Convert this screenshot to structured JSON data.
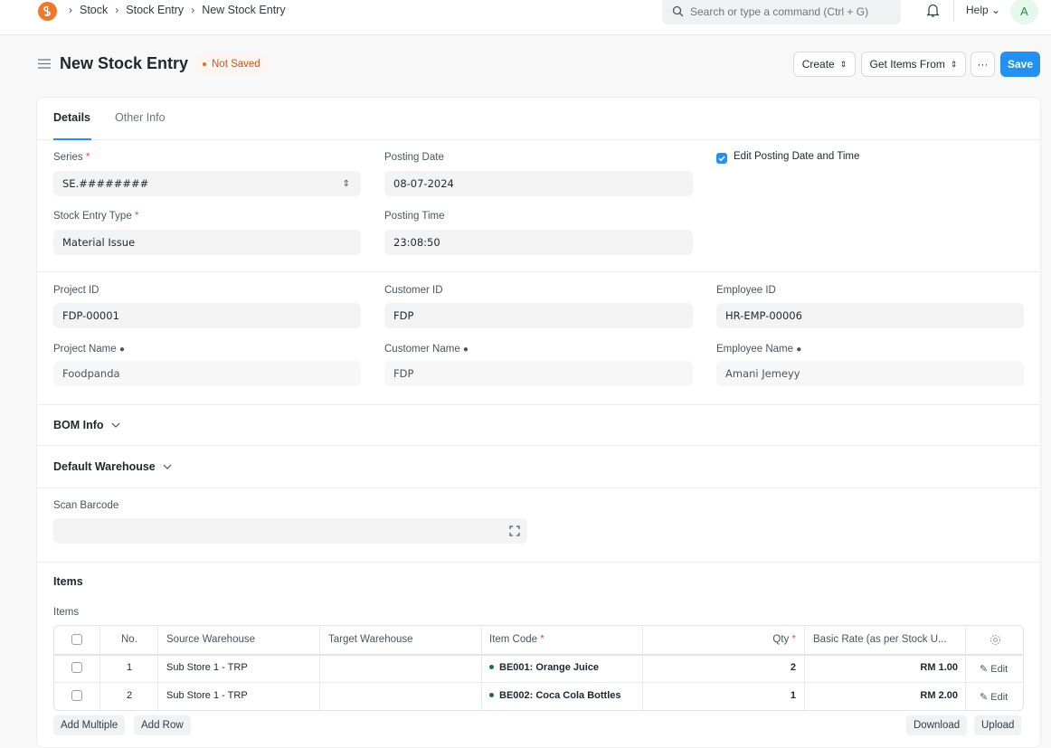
{
  "breadcrumbs": [
    "Stock",
    "Stock Entry",
    "New Stock Entry"
  ],
  "search": {
    "placeholder": "Search or type a command (Ctrl + G)"
  },
  "user": {
    "help_label": "Help",
    "avatar_letter": "A"
  },
  "page": {
    "title": "New Stock Entry",
    "status": "Not Saved"
  },
  "actions": {
    "create": "Create",
    "get_items": "Get Items From",
    "more": "···",
    "save": "Save"
  },
  "tabs": [
    "Details",
    "Other Info"
  ],
  "fields": {
    "series": {
      "label": "Series",
      "value": "SE.########"
    },
    "posting_date": {
      "label": "Posting Date",
      "value": "08-07-2024"
    },
    "edit_posting": {
      "label": "Edit Posting Date and Time",
      "checked": true
    },
    "entry_type": {
      "label": "Stock Entry Type",
      "value": "Material Issue"
    },
    "posting_time": {
      "label": "Posting Time",
      "value": "23:08:50"
    },
    "project_id": {
      "label": "Project ID",
      "value": "FDP-00001"
    },
    "customer_id": {
      "label": "Customer ID",
      "value": "FDP"
    },
    "employee_id": {
      "label": "Employee ID",
      "value": "HR-EMP-00006"
    },
    "project_name": {
      "label": "Project Name",
      "value": "Foodpanda"
    },
    "customer_name": {
      "label": "Customer Name",
      "value": "FDP"
    },
    "employee_name": {
      "label": "Employee Name",
      "value": "Amani Jemeyy"
    },
    "scan_barcode": {
      "label": "Scan Barcode",
      "value": ""
    }
  },
  "sections": {
    "bom": "BOM Info",
    "warehouse": "Default Warehouse",
    "items": "Items",
    "items_table_label": "Items"
  },
  "items_table": {
    "headers": [
      "No.",
      "Source Warehouse",
      "Target Warehouse",
      "Item Code",
      "Qty",
      "Basic Rate (as per Stock U..."
    ],
    "rows": [
      {
        "no": "1",
        "source": "Sub Store 1 - TRP",
        "target": "",
        "item": "BE001: Orange Juice",
        "qty": "2",
        "rate": "RM 1.00",
        "edit": "Edit"
      },
      {
        "no": "2",
        "source": "Sub Store 1 - TRP",
        "target": "",
        "item": "BE002: Coca Cola Bottles",
        "qty": "1",
        "rate": "RM 2.00",
        "edit": "Edit"
      }
    ],
    "buttons": {
      "add_multiple": "Add Multiple",
      "add_row": "Add Row",
      "download": "Download",
      "upload": "Upload"
    }
  },
  "colors": {
    "primary": "#2490ef",
    "logo": "#f0782d",
    "status": "#c4561c"
  }
}
